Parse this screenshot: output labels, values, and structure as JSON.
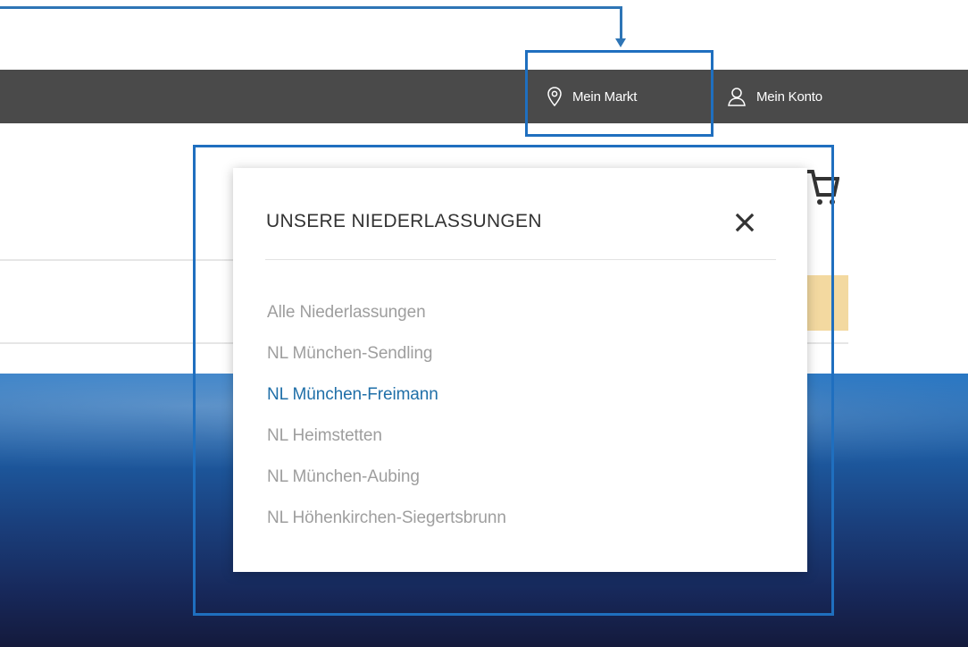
{
  "topbar": {
    "mein_markt_label": "Mein Markt",
    "mein_konto_label": "Mein Konto"
  },
  "popup": {
    "title": "UNSERE NIEDERLASSUNGEN",
    "branches": [
      "Alle Niederlassungen",
      "NL München-Sendling",
      "NL München-Freimann",
      "NL Heimstetten",
      "NL München-Aubing",
      "NL Höhenkirchen-Siegertsbrunn"
    ],
    "active_branch": "NL München-Freimann"
  },
  "icons": {
    "location": "location-pin-icon",
    "account": "user-icon",
    "close": "close-icon",
    "cart": "cart-icon"
  },
  "colors": {
    "annotation": "#1f6fbf",
    "topbar": "#4a4a4a",
    "active_link": "#1f6fa8",
    "inactive_link": "#9e9e9e"
  }
}
